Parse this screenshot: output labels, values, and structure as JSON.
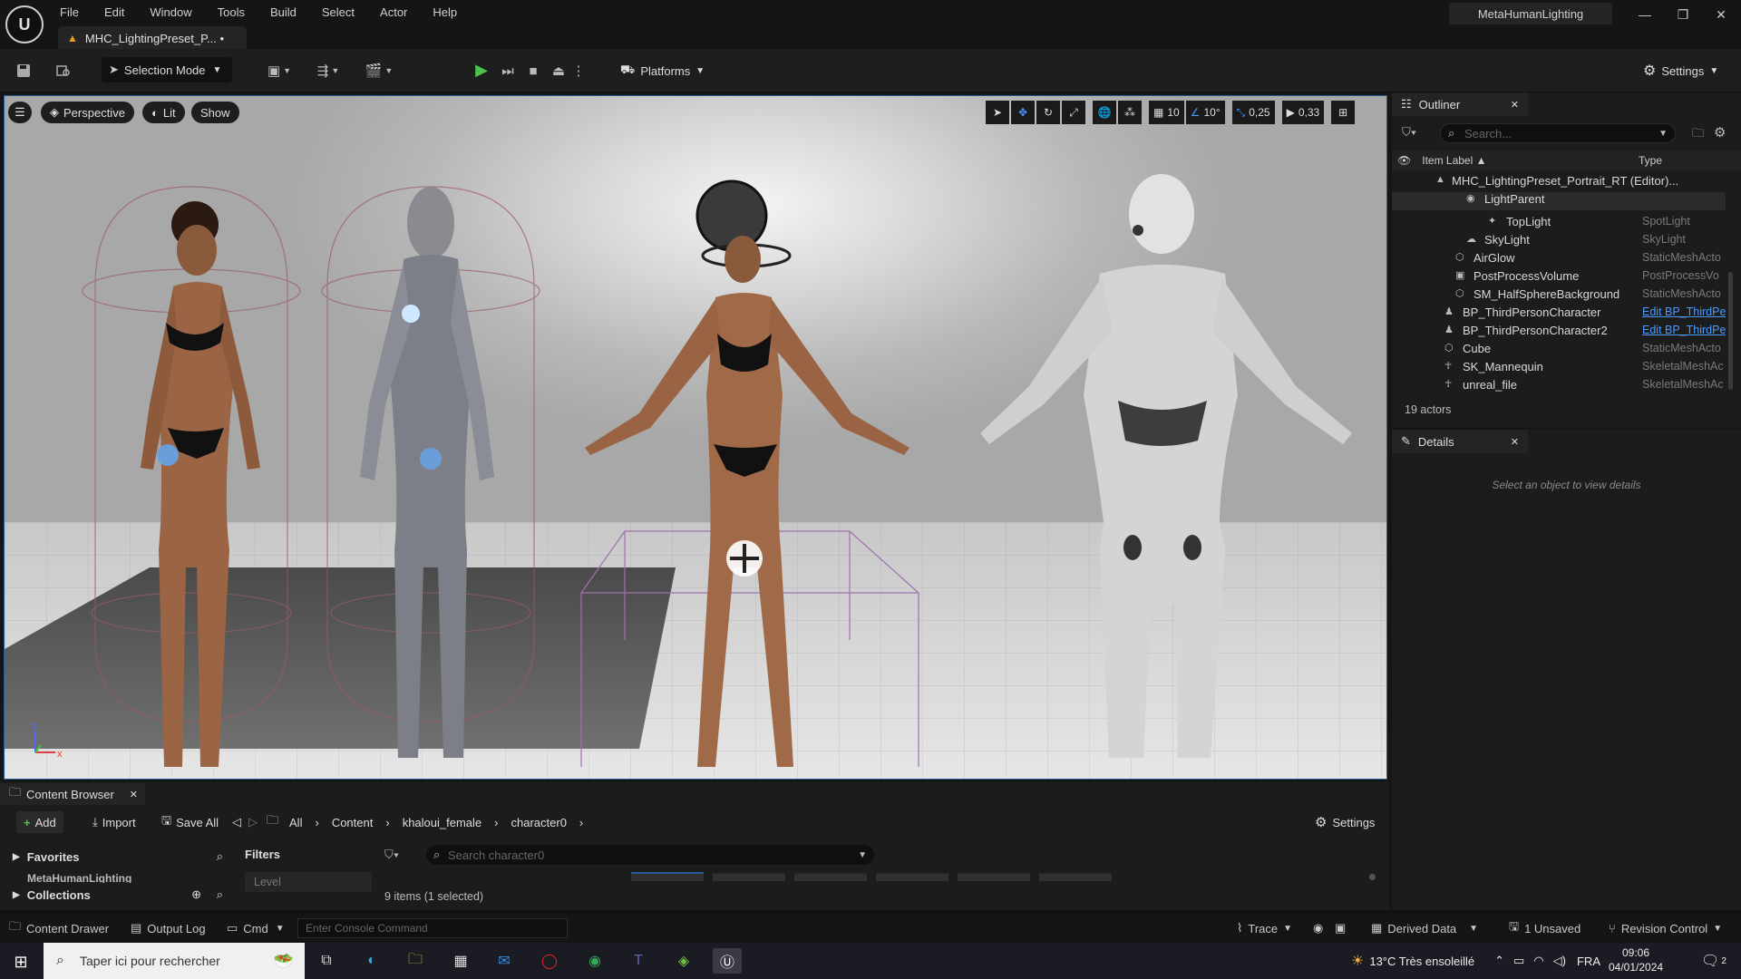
{
  "window": {
    "logo": "U",
    "document_tab": "MHC_LightingPreset_P... •",
    "project_name": "MetaHumanLighting",
    "controls": {
      "minimize": "—",
      "restore": "❐",
      "close": "✕"
    }
  },
  "menu": [
    "File",
    "Edit",
    "Window",
    "Tools",
    "Build",
    "Select",
    "Actor",
    "Help"
  ],
  "toolbar": {
    "selection_mode": "Selection Mode",
    "platforms": "Platforms",
    "settings": "Settings",
    "colors": {
      "play": "#4cc14c"
    }
  },
  "viewport": {
    "perspective": "Perspective",
    "lit": "Lit",
    "show": "Show",
    "grid_size": "10",
    "rotation_snap": "10°",
    "scale_snap": "0,25",
    "camera_speed": "0,33",
    "axis_x": "x",
    "axis_z": "z"
  },
  "outliner": {
    "tab": "Outliner",
    "search_placeholder": "Search...",
    "col_label": "Item Label ▲",
    "col_type": "Type",
    "rows": [
      {
        "label": "MHC_LightingPreset_Portrait_RT (Editor)...",
        "type": "",
        "icon": "level-icon"
      },
      {
        "label": "LightParent",
        "type": "",
        "icon": "actor-icon"
      },
      {
        "label": "TopLight",
        "type": "SpotLight",
        "icon": "spotlight-icon"
      },
      {
        "label": "SkyLight",
        "type": "SkyLight",
        "icon": "skylight-icon"
      },
      {
        "label": "AirGlow",
        "type": "StaticMeshActo",
        "icon": "mesh-icon"
      },
      {
        "label": "PostProcessVolume",
        "type": "PostProcessVo",
        "icon": "volume-icon"
      },
      {
        "label": "SM_HalfSphereBackground",
        "type": "StaticMeshActo",
        "icon": "mesh-icon"
      },
      {
        "label": "BP_ThirdPersonCharacter",
        "type": "Edit BP_ThirdPe",
        "icon": "pawn-icon",
        "link": true
      },
      {
        "label": "BP_ThirdPersonCharacter2",
        "type": "Edit BP_ThirdPe",
        "icon": "pawn-icon",
        "link": true
      },
      {
        "label": "Cube",
        "type": "StaticMeshActo",
        "icon": "mesh-icon"
      },
      {
        "label": "SK_Mannequin",
        "type": "SkeletalMeshAc",
        "icon": "skeletal-icon"
      },
      {
        "label": "unreal_file",
        "type": "SkeletalMeshAc",
        "icon": "skeletal-icon"
      }
    ],
    "count": "19 actors"
  },
  "details": {
    "tab": "Details",
    "empty": "Select an object to view details"
  },
  "content_browser": {
    "tab": "Content Browser",
    "add": "Add",
    "import": "Import",
    "save_all": "Save All",
    "breadcrumb": [
      "All",
      "Content",
      "khaloui_female",
      "character0"
    ],
    "settings": "Settings",
    "favorites": "Favorites",
    "metahuman": "MetaHumanLighting",
    "collections": "Collections",
    "filters": "Filters",
    "level_filter": "Level",
    "search_placeholder": "Search character0",
    "items": "9 items (1 selected)"
  },
  "statusbar": {
    "content_drawer": "Content Drawer",
    "output_log": "Output Log",
    "cmd": "Cmd",
    "console_placeholder": "Enter Console Command",
    "trace": "Trace",
    "derived_data": "Derived Data",
    "unsaved": "1 Unsaved",
    "revision_control": "Revision Control"
  },
  "taskbar": {
    "search": "Taper ici pour rechercher",
    "weather": "13°C  Très ensoleillé",
    "lang": "FRA",
    "time": "09:06",
    "date": "04/01/2024",
    "notifications": "2"
  }
}
